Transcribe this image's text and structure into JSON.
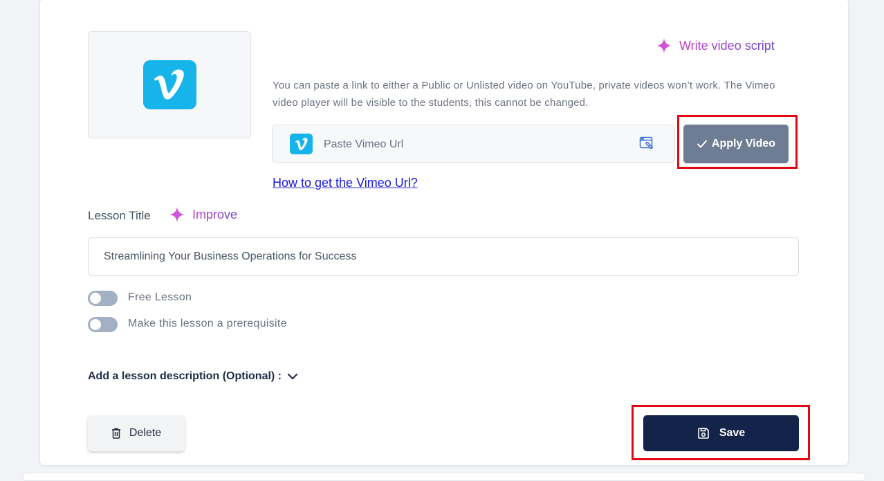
{
  "video": {
    "provider_logo": "vimeo-logo",
    "write_script_label": "Write video script",
    "help_text": "You can paste a link to either a Public or Unlisted video on YouTube, private videos won’t work. The Vimeo video player will be visible to the students, this cannot be changed.",
    "url_placeholder": "Paste Vimeo Url",
    "url_value": "",
    "apply_label": "Apply Video",
    "howto_link": "How to get the Vimeo Url?"
  },
  "lesson": {
    "title_label": "Lesson Title",
    "improve_label": "Improve",
    "title_value": "Streamlining Your Business Operations for Success",
    "free_lesson_label": "Free Lesson",
    "free_lesson_on": false,
    "prerequisite_label": "Make this lesson a prerequisite",
    "prerequisite_on": false,
    "description_toggle": "Add a lesson description (Optional) :"
  },
  "actions": {
    "delete_label": "Delete",
    "save_label": "Save"
  },
  "colors": {
    "vimeo_blue": "#17b4ea",
    "ai_gradient_start": "#c43fc7",
    "ai_gradient_end": "#6b45c9",
    "apply_button": "#6f7d94",
    "save_button": "#13234a",
    "highlight": "#e30613",
    "link": "#1a1ae0"
  }
}
